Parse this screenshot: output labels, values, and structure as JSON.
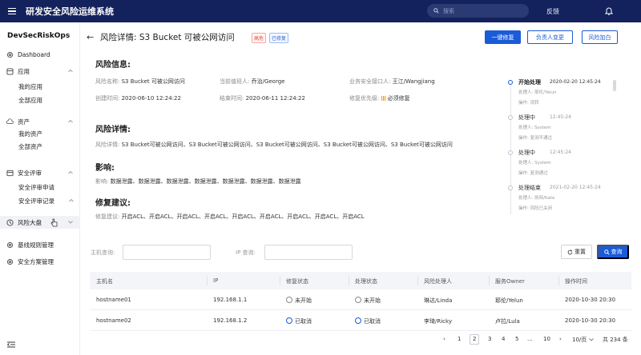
{
  "topbar": {
    "title": "研发安全风险运维系统",
    "search_placeholder": "搜索",
    "feedback": "反馈"
  },
  "sidebar": {
    "brand": "DevSecRiskOps",
    "dashboard": "Dashboard",
    "apps": "应用",
    "my_apps": "我的应用",
    "all_apps": "全部应用",
    "assets": "资产",
    "my_assets": "我的资产",
    "all_assets": "全部资产",
    "review": "安全评审",
    "review_apply": "安全评审申请",
    "review_records": "安全评审记录",
    "risk_board": "风险大盘",
    "baseline": "基线规则管理",
    "solutions": "安全方案管理"
  },
  "header": {
    "title": "风险详情: S3 Bucket 可被公网访问",
    "badge_high": "高危",
    "badge_fixed": "已修复",
    "btn_fix": "一键修复",
    "btn_owner": "负责人变更",
    "btn_whitelist": "风险加白"
  },
  "info": {
    "section_title": "风险信息:",
    "name_label": "风险名称:",
    "name_value": "S3 Bucket 可被公网访问",
    "duty_label": "当前值班人:",
    "duty_value": "乔治/George",
    "contact_label": "业务安全接口人:",
    "contact_value": "王江/Wangjiang",
    "created_label": "创建时间:",
    "created_value": "2020-06-10 12:24:22",
    "ended_label": "结束时间:",
    "ended_value": "2020-06-11 12:24:22",
    "priority_label": "修复优先级:",
    "priority_value": "必须修复"
  },
  "details": {
    "section_title": "风险详情:",
    "label": "风险详情:",
    "text": "S3 Bucket可被公网访问、S3 Bucket可被公网访问、S3 Bucket可被公网访问、S3 Bucket可被公网访问、S3 Bucket可被公网访问"
  },
  "impact": {
    "section_title": "影响:",
    "label": "影响:",
    "text": "数据泄露、数据泄露、数据泄露、数据泄露、数据泄露、数据泄露、数据泄露"
  },
  "advice": {
    "section_title": "修复建议:",
    "label": "修复建议:",
    "text": "开启ACL、开启ACL、开启ACL、开启ACL、开启ACL、开启ACL、开启ACL、开启ACL、开启ACL"
  },
  "timeline": [
    {
      "status": "开始处理",
      "time": "2020-02-20 12:45:24",
      "line1": "处理人: 耶伦/Yelun",
      "line2": "操作: 流转",
      "current": true
    },
    {
      "status": "处理中",
      "time": "12:45:24",
      "line1": "处理人: System",
      "line2": "操作: 复测不通过",
      "current": false
    },
    {
      "status": "处理中",
      "time": "12:45:24",
      "line1": "处理人: System",
      "line2": "操作: 复测通过",
      "current": false
    },
    {
      "status": "处理结束",
      "time": "2021-02-20 12:45:24",
      "line1": "处理人: 凯特/Kate",
      "line2": "操作: 风险已关闭",
      "current": false
    }
  ],
  "filter": {
    "host_label": "主机查询:",
    "ip_label": "IP 查询:",
    "reset": "重置",
    "query": "查询"
  },
  "table": {
    "headers": [
      "主机名",
      "IP",
      "修复状态",
      "处理状态",
      "风险处理人",
      "服务Owner",
      "操作时间"
    ],
    "rows": [
      [
        "hostname01",
        "192.168.1.1",
        "未开始",
        "未开始",
        "琳达/Linda",
        "耶伦/Yelun",
        "2020-10-30 20:30"
      ],
      [
        "hostname02",
        "192.168.1.2",
        "已取消",
        "已取消",
        "李琦/Ricky",
        "卢拉/Lula",
        "2020-10-30 20:30"
      ]
    ]
  },
  "pagination": {
    "prev": "‹",
    "pages": [
      "1",
      "2",
      "3",
      "4",
      "5",
      "...",
      "10"
    ],
    "next": "›",
    "page_size": "10/页",
    "total": "共 234 条"
  }
}
